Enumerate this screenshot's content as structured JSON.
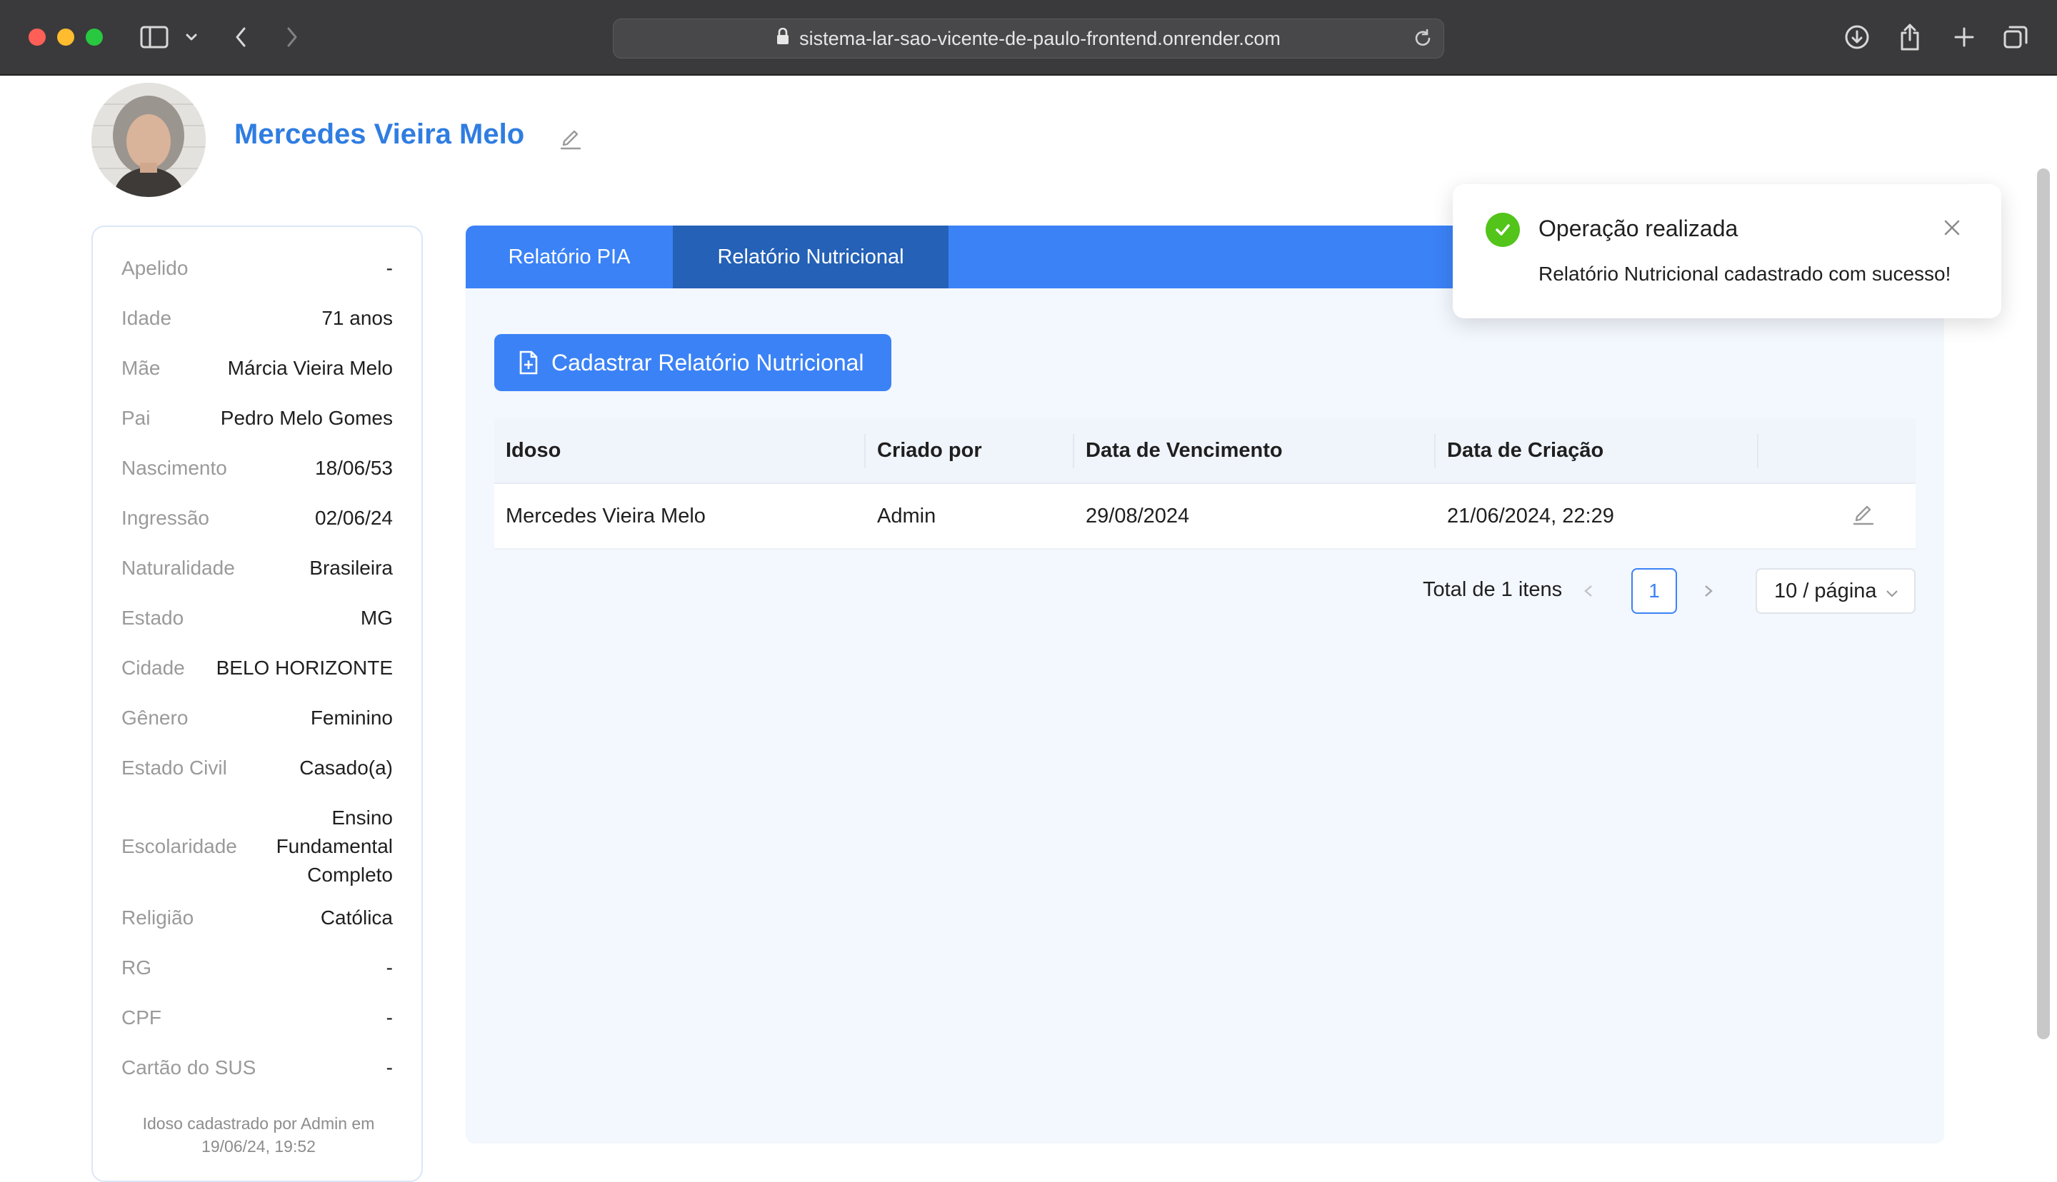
{
  "browser": {
    "url": "sistema-lar-sao-vicente-de-paulo-frontend.onrender.com"
  },
  "profile": {
    "name": "Mercedes Vieira Melo"
  },
  "details": {
    "rows": [
      {
        "label": "Apelido",
        "value": "-"
      },
      {
        "label": "Idade",
        "value": "71 anos"
      },
      {
        "label": "Mãe",
        "value": "Márcia Vieira Melo"
      },
      {
        "label": "Pai",
        "value": "Pedro Melo Gomes"
      },
      {
        "label": "Nascimento",
        "value": "18/06/53"
      },
      {
        "label": "Ingressão",
        "value": "02/06/24"
      },
      {
        "label": "Naturalidade",
        "value": "Brasileira"
      },
      {
        "label": "Estado",
        "value": "MG"
      },
      {
        "label": "Cidade",
        "value": "BELO HORIZONTE"
      },
      {
        "label": "Gênero",
        "value": "Feminino"
      },
      {
        "label": "Estado Civil",
        "value": "Casado(a)"
      },
      {
        "label": "Escolaridade",
        "value_lines": [
          "Ensino",
          "Fundamental",
          "Completo"
        ]
      },
      {
        "label": "Religião",
        "value": "Católica"
      },
      {
        "label": "RG",
        "value": "-"
      },
      {
        "label": "CPF",
        "value": "-"
      },
      {
        "label": "Cartão do SUS",
        "value": "-"
      }
    ],
    "footer_line1": "Idoso cadastrado por Admin em",
    "footer_line2": "19/06/24, 19:52"
  },
  "tabs": [
    {
      "label": "Relatório PIA",
      "active": false
    },
    {
      "label": "Relatório Nutricional",
      "active": true
    }
  ],
  "create_button": {
    "label": "Cadastrar Relatório Nutricional"
  },
  "table": {
    "headers": [
      "Idoso",
      "Criado por",
      "Data de Vencimento",
      "Data de Criação"
    ],
    "rows": [
      [
        "Mercedes Vieira Melo",
        "Admin",
        "29/08/2024",
        "21/06/2024, 22:29"
      ]
    ]
  },
  "pagination": {
    "total_text": "Total de 1 itens",
    "current_page": "1",
    "page_size": "10 / página"
  },
  "toast": {
    "title": "Operação realizada",
    "message": "Relatório Nutricional cadastrado com sucesso!"
  },
  "colors": {
    "accent": "#3b82f6",
    "accent_dark": "#2461b7",
    "name_blue": "#2f7de1",
    "success": "#52c41a"
  }
}
